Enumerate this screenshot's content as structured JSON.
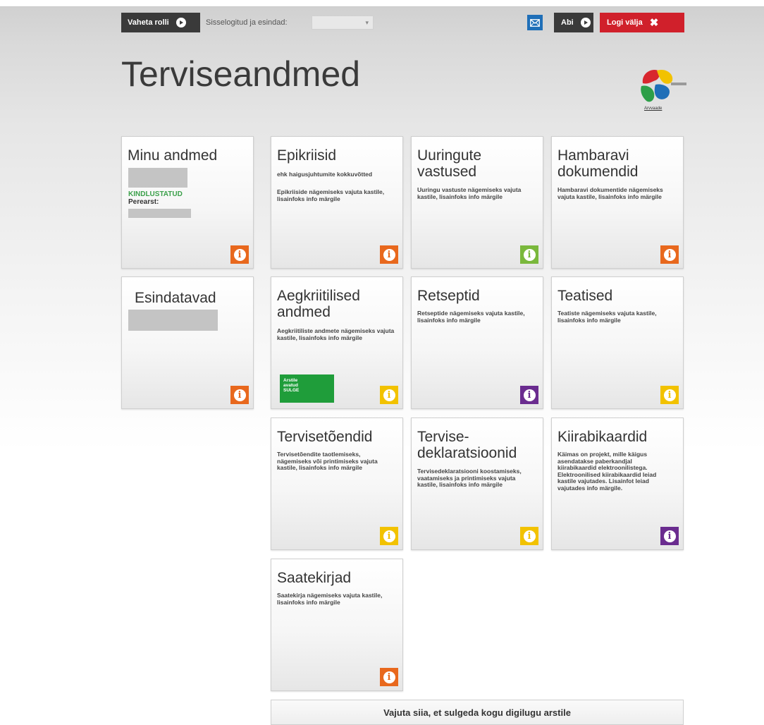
{
  "topbar": {
    "role_button": "Vaheta rolli",
    "logged_label": "Sisselogitud ja esindad:",
    "logged_value": "",
    "mail_icon": "envelope-icon",
    "help_button": "Abi",
    "logout_button": "Logi välja"
  },
  "page": {
    "title": "Terviseandmed",
    "logo_caption": "Arvvaade"
  },
  "colors": {
    "orange": "#e8681d",
    "green": "#7ab83c",
    "yellow": "#f2c200",
    "purple": "#6a2c8f",
    "logout_red": "#d0202b",
    "mail_blue": "#1f6fb8"
  },
  "tiles": {
    "minu": {
      "title": "Minu andmed",
      "status": "KINDLUSTATUD",
      "perearst": "Perearst:"
    },
    "esindatavad": {
      "title": "Esindatavad"
    },
    "epikriisid": {
      "title": "Epikriisid",
      "subtitle": "ehk haigusjuhtumite kokkuvõtted",
      "desc": "Epikriiside nägemiseks vajuta kastile, lisainfoks info märgile"
    },
    "uuringute": {
      "title": "Uuringute vastused",
      "desc": "Uuringu vastuste nägemiseks vajuta kastile, lisainfoks info märgile"
    },
    "hambaravi": {
      "title": "Hambaravi dokumendid",
      "desc": "Hambaravi dokumentide nägemiseks vajuta kastile, lisainfoks info märgile"
    },
    "aegkriitilised": {
      "title": "Aegkriitilised andmed",
      "desc": "Aegkriitiliste andmete nägemiseks vajuta kastile, lisainfoks info märgile",
      "badge_line1": "Arstile",
      "badge_line2": "avatud",
      "badge_line3": "SULGE"
    },
    "retseptid": {
      "title": "Retseptid",
      "desc": "Retseptide nägemiseks vajuta kastile, lisainfoks info märgile"
    },
    "teatised": {
      "title": "Teatised",
      "desc": "Teatiste nägemiseks vajuta kastile, lisainfoks info märgile"
    },
    "tervisetoendid": {
      "title": "Tervisetõendid",
      "desc": "Tervisetõendite taotlemiseks, nägemiseks või printimiseks vajuta kastile, lisainfoks info märgile"
    },
    "tervisedekl": {
      "title": "Tervise-deklaratsioonid",
      "desc": "Tervisedeklaratsiooni koostamiseks, vaatamiseks ja printimiseks vajuta kastile, lisainfoks info märgile"
    },
    "kiirabi": {
      "title": "Kiirabikaardid",
      "desc": "Käimas on projekt, mille käigus asendatakse paberkandjal kiirabikaardid elektroonilistega. Elektroonilised kiirabikaardid leiad kastile vajutades. Lisainfot leiad vajutades info märgile."
    },
    "saatekirjad": {
      "title": "Saatekirjad",
      "desc": "Saatekirja nägemiseks vajuta kastile, lisainfoks info märgile"
    }
  },
  "info_icon": "info-icon",
  "close_all_button": "Vajuta siia, et sulgeda kogu digilugu arstile"
}
